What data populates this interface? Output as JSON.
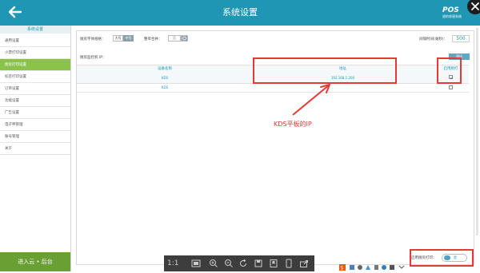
{
  "topbar": {
    "title": "系统设置",
    "brand_name": "POS",
    "brand_sub": "银豹收银系统"
  },
  "sidebar": {
    "header": "系统设置",
    "items": [
      {
        "label": "通用设置"
      },
      {
        "label": "小票打印设置"
      },
      {
        "label": "厨房打印设置",
        "active": true
      },
      {
        "label": "标签打印设置"
      },
      {
        "label": "订单设置"
      },
      {
        "label": "功能设置"
      },
      {
        "label": "广告设置"
      },
      {
        "label": "电子秤管理"
      },
      {
        "label": "账号管理"
      },
      {
        "label": "关于"
      }
    ],
    "footer": "进入云 • 后台"
  },
  "settings": {
    "font_size_label": "厨房字体规格：",
    "font_size_options": [
      "大号",
      "中号"
    ],
    "font_size_selected": "中号",
    "merge_label": "整单合并：",
    "merge_value": "否",
    "poll_label": "间隔时间(毫秒)：",
    "poll_value": "500",
    "ip_label": "厨房监控机 IP：",
    "test_button": "测试"
  },
  "table": {
    "headers": [
      "设备名称",
      "地址",
      "启用厨打"
    ],
    "rows": [
      {
        "name": "KDS",
        "ip": "192.168.1.200",
        "enabled": true
      },
      {
        "name": "KDS",
        "ip": "",
        "enabled": false
      }
    ]
  },
  "annotation": {
    "text": "KDS平板的IP",
    "color": "#e53935"
  },
  "footer_toggle": {
    "label": "启用厨房打印：",
    "value": "是"
  },
  "viewer": {
    "ratio": "1:1"
  },
  "colors": {
    "accent": "#1e96b4",
    "sidebar_active": "#8bc34a",
    "footer": "#6aa033"
  }
}
